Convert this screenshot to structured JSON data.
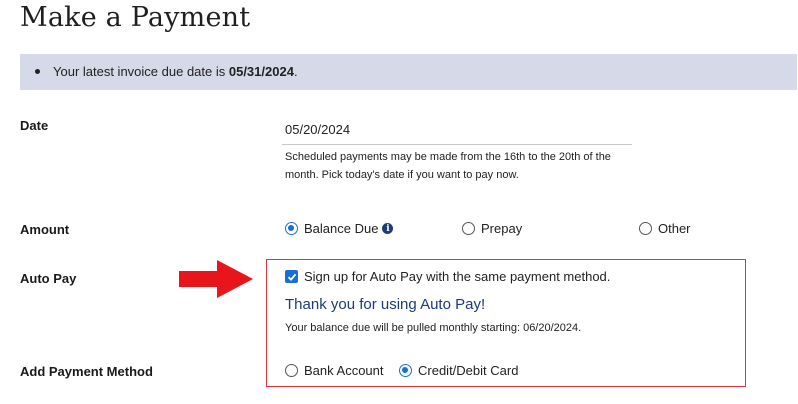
{
  "page": {
    "title": "Make a Payment"
  },
  "notice": {
    "prefix": "Your latest invoice due date is ",
    "due_date": "05/31/2024",
    "suffix": "."
  },
  "date": {
    "label": "Date",
    "value": "05/20/2024",
    "help": "Scheduled payments may be made from the 16th to the 20th of the month. Pick today's date if you want to pay now."
  },
  "amount": {
    "label": "Amount",
    "options": [
      {
        "label": "Balance Due",
        "selected": true,
        "info_icon": "info-icon"
      },
      {
        "label": "Prepay",
        "selected": false
      },
      {
        "label": "Other",
        "selected": false
      }
    ]
  },
  "autopay": {
    "label": "Auto Pay",
    "checkbox_label": "Sign up for Auto Pay with the same payment method.",
    "checked": true,
    "thanks": "Thank you for using Auto Pay!",
    "pull_note": "Your balance due will be pulled monthly starting: 06/20/2024."
  },
  "payment_method": {
    "label": "Add Payment Method",
    "options": [
      {
        "label": "Bank Account",
        "selected": false
      },
      {
        "label": "Credit/Debit Card",
        "selected": true
      }
    ]
  },
  "colors": {
    "notice_bg": "#d6d9e7",
    "accent_blue": "#1a6fd1",
    "highlight_red": "#d9363e",
    "heading_navy": "#1e3a78"
  }
}
